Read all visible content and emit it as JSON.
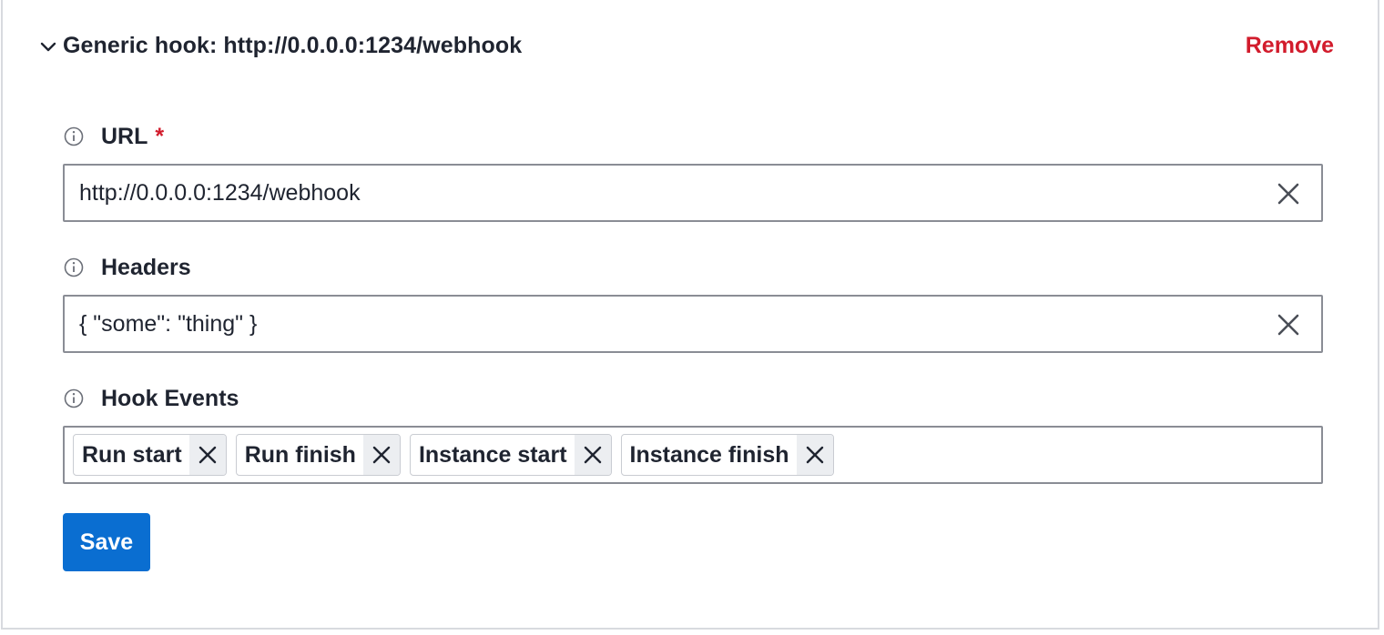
{
  "hook": {
    "title": "Generic hook: http://0.0.0.0:1234/webhook",
    "remove_label": "Remove"
  },
  "fields": {
    "url": {
      "label": "URL",
      "required_marker": "*",
      "value": "http://0.0.0.0:1234/webhook"
    },
    "headers": {
      "label": "Headers",
      "value": "{ \"some\": \"thing\" }"
    },
    "hook_events": {
      "label": "Hook Events",
      "tags": [
        "Run start",
        "Run finish",
        "Instance start",
        "Instance finish"
      ]
    }
  },
  "actions": {
    "save_label": "Save"
  },
  "colors": {
    "accent": "#0a6ed1",
    "danger": "#d21c2c",
    "border": "#8a8d95"
  },
  "icons": {
    "collapse": "chevron-down-icon",
    "info": "info-icon",
    "clear": "close-icon"
  }
}
